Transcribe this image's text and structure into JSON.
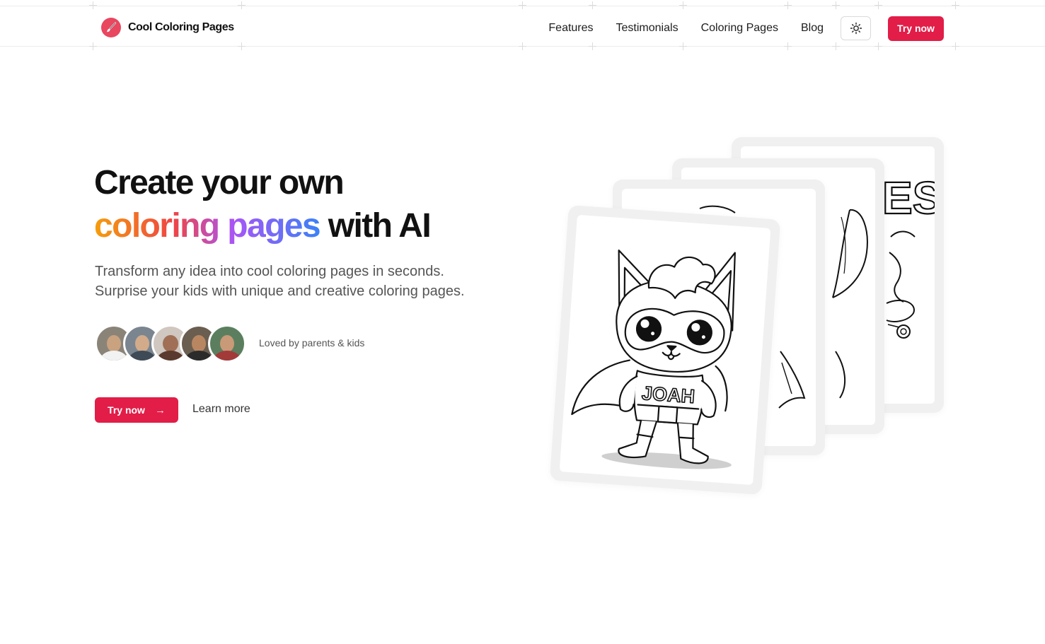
{
  "header": {
    "brand": "Cool Coloring Pages",
    "nav": [
      "Features",
      "Testimonials",
      "Coloring Pages",
      "Blog"
    ],
    "theme_icon": "sun-icon",
    "cta_label": "Try now"
  },
  "hero": {
    "title_line1": "Create your own",
    "title_gradient": "coloring pages",
    "title_rest": " with AI",
    "subtitle_line1": "Transform any idea into cool coloring pages in seconds.",
    "subtitle_line2": "Surprise your kids with unique and creative coloring pages.",
    "social_proof": "Loved by parents & kids",
    "cta_label": "Try now",
    "learn_more": "Learn more"
  },
  "cards": {
    "front_shirt_text": "JOAH",
    "back_fragment_text": "ES"
  },
  "colors": {
    "accent": "#e21d48",
    "gradient": [
      "#f59e0b",
      "#ef4444",
      "#a855f7",
      "#3b82f6"
    ]
  }
}
